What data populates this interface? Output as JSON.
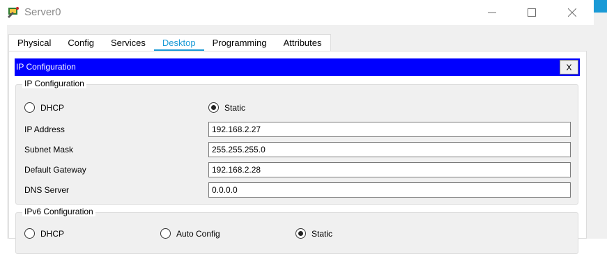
{
  "window": {
    "title": "Server0",
    "controls": {
      "minimize": "—",
      "maximize": "☐",
      "close": "✕"
    }
  },
  "tabs": [
    {
      "label": "Physical"
    },
    {
      "label": "Config"
    },
    {
      "label": "Services"
    },
    {
      "label": "Desktop",
      "active": true
    },
    {
      "label": "Programming"
    },
    {
      "label": "Attributes"
    }
  ],
  "ip_config": {
    "header_title": "IP Configuration",
    "close_label": "X",
    "ipv4": {
      "legend": "IP Configuration",
      "dhcp_label": "DHCP",
      "static_label": "Static",
      "mode": "static",
      "fields": {
        "ip_address": {
          "label": "IP Address",
          "value": "192.168.2.27"
        },
        "subnet_mask": {
          "label": "Subnet Mask",
          "value": "255.255.255.0"
        },
        "default_gateway": {
          "label": "Default Gateway",
          "value": "192.168.2.28"
        },
        "dns_server": {
          "label": "DNS Server",
          "value": "0.0.0.0"
        }
      }
    },
    "ipv6": {
      "legend": "IPv6 Configuration",
      "dhcp_label": "DHCP",
      "auto_config_label": "Auto Config",
      "static_label": "Static",
      "mode": "static"
    }
  },
  "colors": {
    "header_bg": "#0000ff",
    "tab_accent": "#1a9ad6",
    "window_bg": "#f0f0f0"
  }
}
